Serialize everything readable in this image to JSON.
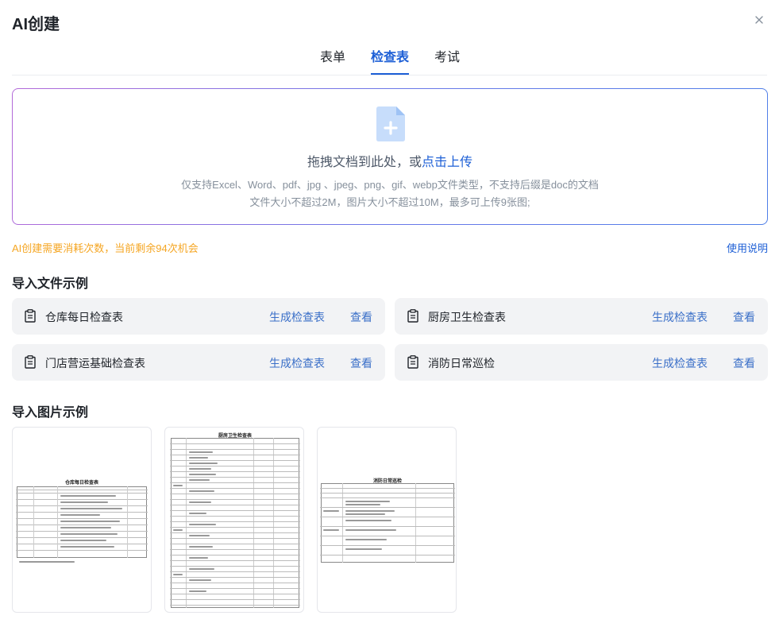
{
  "header": {
    "title": "AI创建",
    "close_icon": "close-icon"
  },
  "tabs": [
    {
      "label": "表单",
      "active": false
    },
    {
      "label": "检查表",
      "active": true
    },
    {
      "label": "考试",
      "active": false
    }
  ],
  "upload": {
    "icon": "file-add-icon",
    "main_text": "拖拽文档到此处，或",
    "link_text": "点击上传",
    "hint1": "仅支持Excel、Word、pdf、jpg 、jpeg、png、gif、webp文件类型，不支持后缀是doc的文档",
    "hint2": "文件大小不超过2M，图片大小不超过10M，最多可上传9张图;"
  },
  "quota": {
    "text": "AI创建需要消耗次数，当前剩余94次机会",
    "help_link": "使用说明"
  },
  "file_examples": {
    "title": "导入文件示例",
    "items": [
      {
        "name": "仓库每日检查表",
        "generate": "生成检查表",
        "view": "查看"
      },
      {
        "name": "厨房卫生检查表",
        "generate": "生成检查表",
        "view": "查看"
      },
      {
        "name": "门店营运基础检查表",
        "generate": "生成检查表",
        "view": "查看"
      },
      {
        "name": "消防日常巡检",
        "generate": "生成检查表",
        "view": "查看"
      }
    ]
  },
  "image_examples": {
    "title": "导入图片示例",
    "items": [
      {
        "caption": "仓库每日检查表"
      },
      {
        "caption": "厨房卫生检查表"
      },
      {
        "caption": "消防日常巡检"
      }
    ]
  },
  "colors": {
    "accent": "#1d5fd6",
    "warning": "#f5a623",
    "link": "#3a6fc8",
    "card_bg": "#f2f3f5"
  }
}
